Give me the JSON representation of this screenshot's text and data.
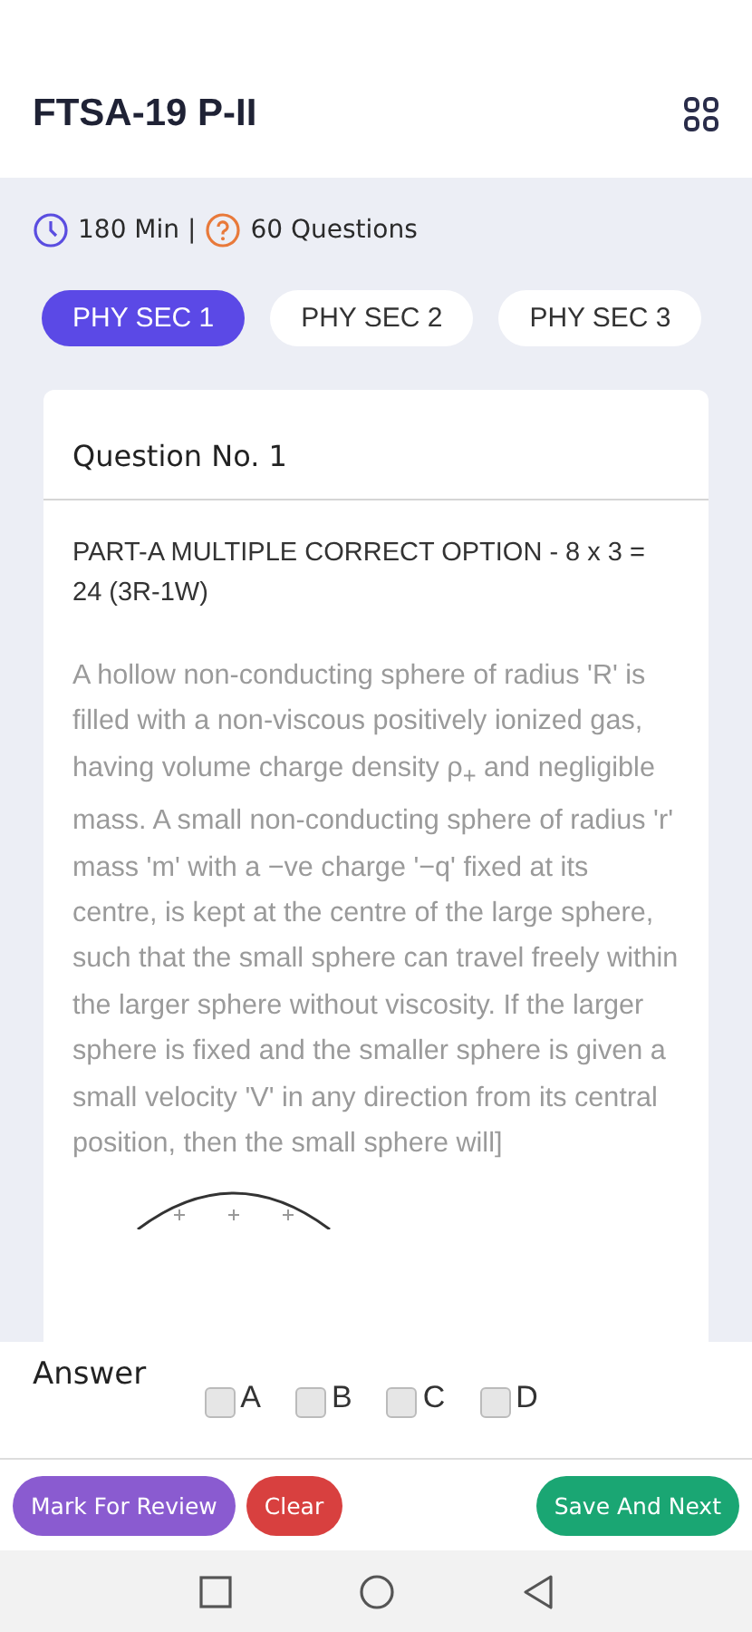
{
  "header": {
    "title": "FTSA-19 P-II"
  },
  "info": {
    "duration": "180 Min |",
    "questions": "60 Questions"
  },
  "tabs": [
    {
      "label": "PHY SEC 1",
      "selected": true
    },
    {
      "label": "PHY SEC 2",
      "selected": false
    },
    {
      "label": "PHY SEC 3",
      "selected": false
    }
  ],
  "question": {
    "number": "Question No. 1",
    "section": "PART-A MULTIPLE CORRECT OPTION - 8 x 3 = 24 (3R-1W)",
    "text": "A hollow non-conducting sphere of radius 'R' is filled with a non-viscous positively ionized gas, having volume charge density ρ$_{+}$ and negligible mass. A small non-conducting sphere of radius 'r' mass 'm' with a −ve charge '−q' fixed at its centre, is kept at the centre of the large sphere, such that the small sphere can travel freely within the larger sphere without viscosity. If the larger sphere is fixed and the smaller sphere is given a small velocity 'V' in any direction from its central position, then the small sphere will]"
  },
  "answer": {
    "label": "Answer",
    "options": [
      {
        "label": "A",
        "checked": false
      },
      {
        "label": "B",
        "checked": false
      },
      {
        "label": "C",
        "checked": false
      },
      {
        "label": "D",
        "checked": false
      }
    ]
  },
  "actions": [
    {
      "kind": "review",
      "label": "Mark For Review"
    },
    {
      "kind": "clear",
      "label": "Clear"
    },
    {
      "kind": "next",
      "label": "Save And Next"
    }
  ]
}
